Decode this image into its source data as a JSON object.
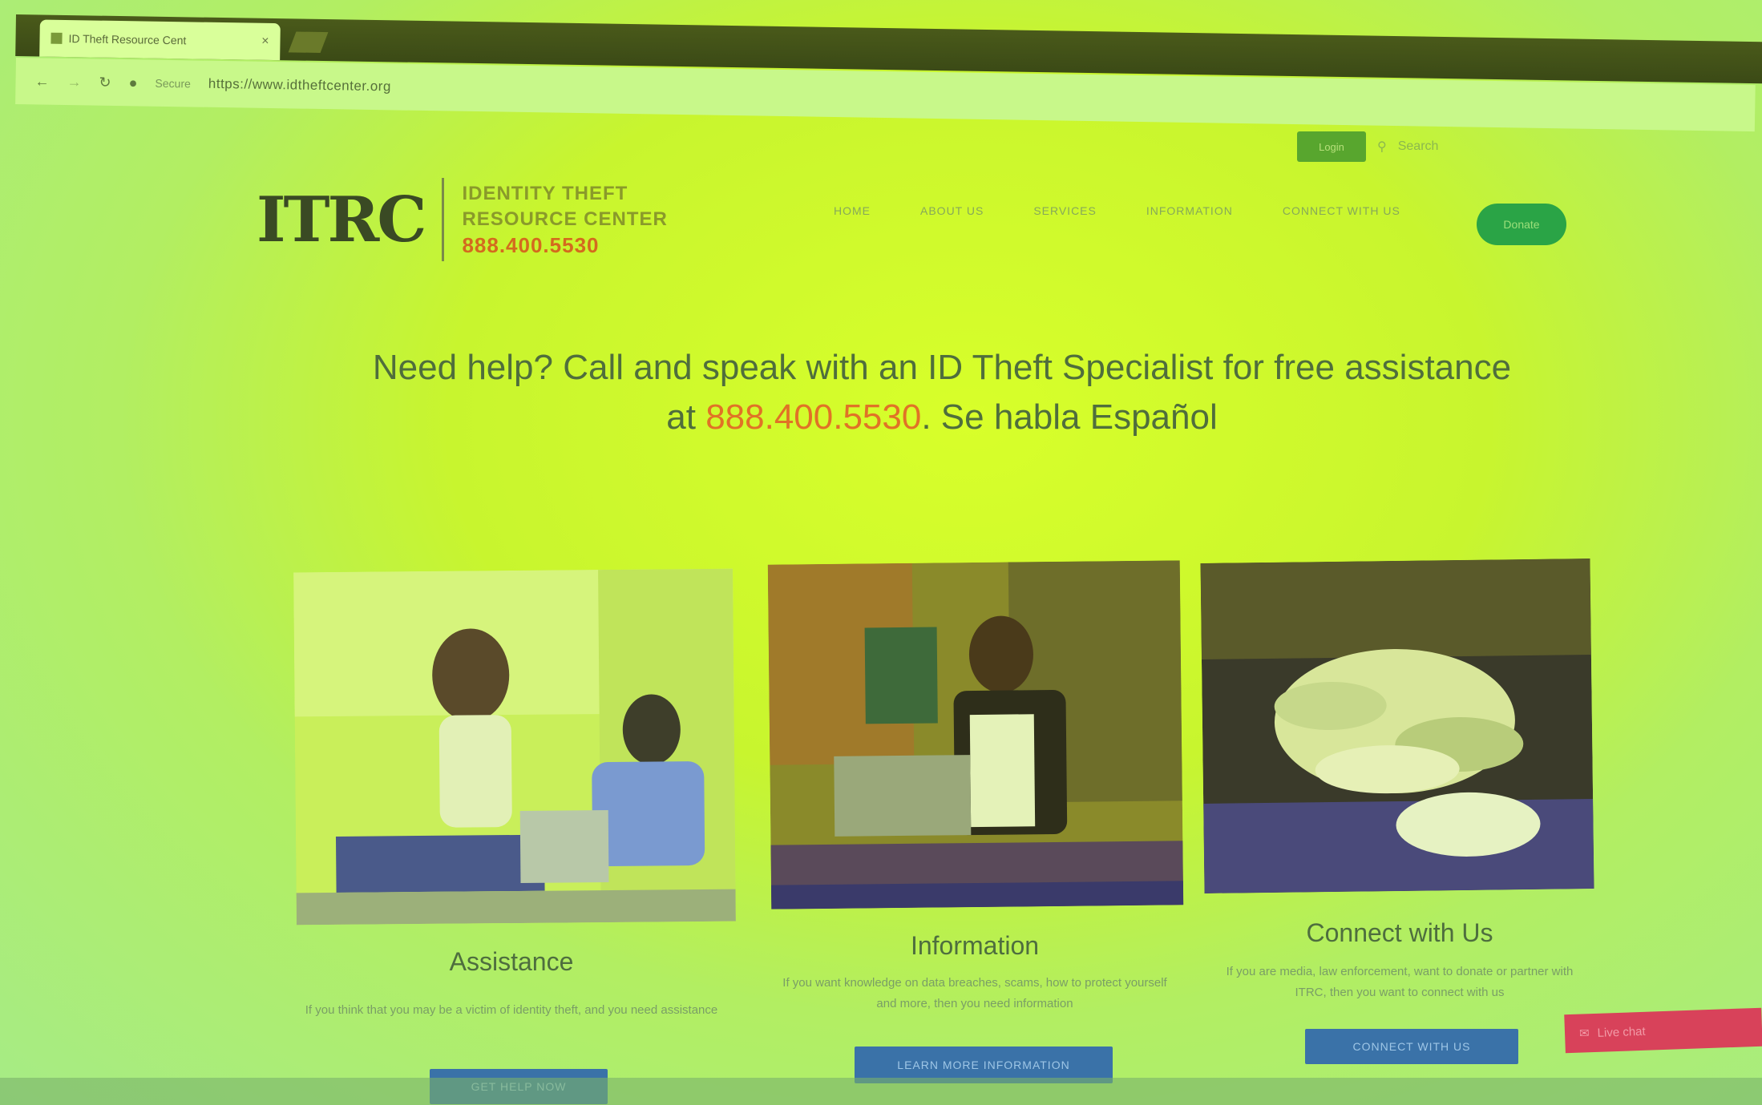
{
  "browser": {
    "tab_title": "ID Theft Resource Cent",
    "tab_close": "×",
    "secure_label": "Secure",
    "url": "https://www.idtheftcenter.org"
  },
  "header": {
    "utility_button": "Login",
    "search_placeholder": "Search",
    "logo_mark": "ITRC",
    "logo_line1": "IDENTITY THEFT",
    "logo_line2": "RESOURCE CENTER",
    "logo_phone": "888.400.5530",
    "nav": [
      "HOME",
      "ABOUT US",
      "SERVICES",
      "INFORMATION",
      "CONNECT WITH US"
    ],
    "donate_label": "Donate"
  },
  "hero": {
    "line_prefix": "Need help? Call and speak with an ID Theft Specialist for free assistance at ",
    "phone": "888.400.5530",
    "line_suffix": ". Se habla Español"
  },
  "cards": [
    {
      "heading": "Assistance",
      "description": "If you think that you may be a victim of identity theft, and you need assistance",
      "cta": "GET HELP NOW"
    },
    {
      "heading": "Information",
      "description": "If you want knowledge on data breaches, scams, how to protect yourself and more, then you need information",
      "cta": "LEARN MORE INFORMATION"
    },
    {
      "heading": "Connect with Us",
      "description": "If you are media, law enforcement, want to donate or partner with ITRC, then you want to connect with us",
      "cta": "CONNECT WITH US"
    }
  ],
  "chat": {
    "label": "Live chat"
  }
}
